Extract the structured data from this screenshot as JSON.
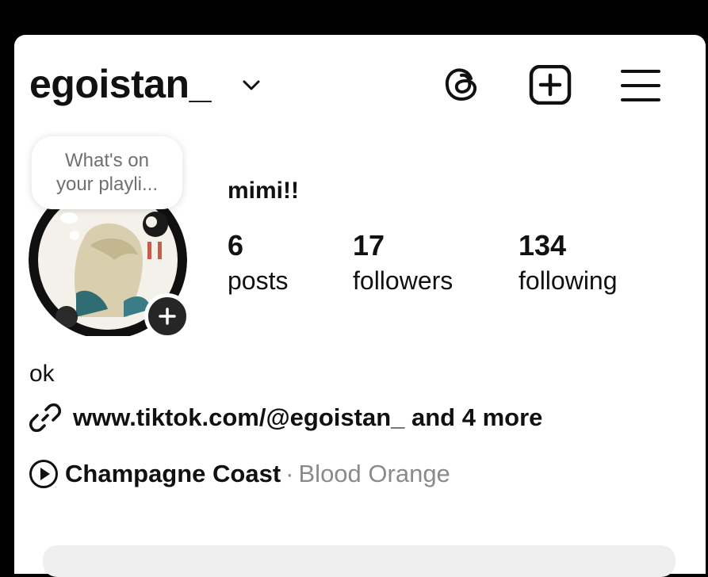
{
  "profile": {
    "username": "egoistan_",
    "display_name": "mimi!!",
    "bio": "ok",
    "link_text": "www.tiktok.com/@egoistan_ and 4 more",
    "note_prompt": "What's on\nyour playli..."
  },
  "header": {
    "icons": [
      "chevron-down-icon",
      "threads-icon",
      "new-post-icon",
      "menu-icon"
    ]
  },
  "stats": [
    {
      "value": "6",
      "label": "posts"
    },
    {
      "value": "17",
      "label": "followers"
    },
    {
      "value": "134",
      "label": "following"
    }
  ],
  "music": {
    "song": "Champagne Coast",
    "separator": "·",
    "artist": "Blood Orange"
  }
}
